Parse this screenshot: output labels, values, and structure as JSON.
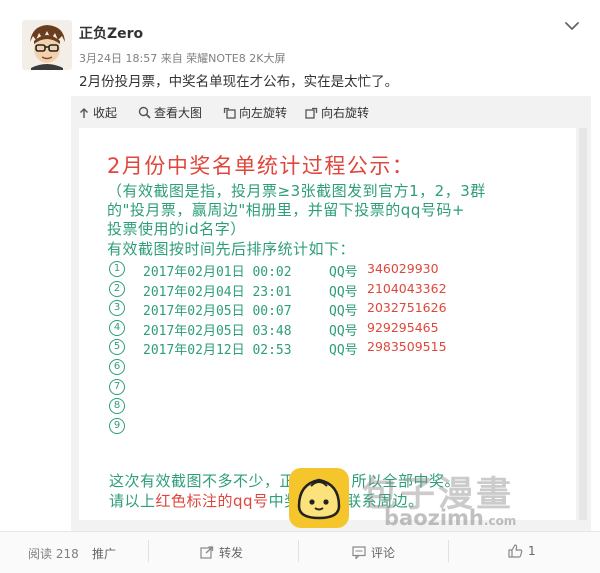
{
  "post": {
    "username": "正负Zero",
    "meta": "3月24日 18:57 来自 荣耀NOTE8 2K大屏",
    "text": "2月份投月票，中奖名单现在才公布，实在是太忙了。"
  },
  "toolbar": {
    "collapse_label": "收起",
    "view_large_label": "查看大图",
    "rotate_left_label": "向左旋转",
    "rotate_right_label": "向右旋转"
  },
  "image": {
    "title": "2月份中奖名单统计过程公示：",
    "note_lines": [
      "（有效截图是指，投月票≥3张截图发到官方1，2，3群",
      "的\"投月票，赢周边\"相册里，并留下投票的qq号码+",
      "投票使用的id名字）",
      "有效截图按时间先后排序统计如下："
    ],
    "entries": [
      {
        "num": "1",
        "date": "2017年02月01日 00:02",
        "qq_label": "QQ号",
        "qq": "346029930"
      },
      {
        "num": "2",
        "date": "2017年02月04日 23:01",
        "qq_label": "QQ号",
        "qq": "2104043362"
      },
      {
        "num": "3",
        "date": "2017年02月05日 00:07",
        "qq_label": "QQ号",
        "qq": "2032751626"
      },
      {
        "num": "4",
        "date": "2017年02月05日 03:48",
        "qq_label": "QQ号",
        "qq": "929295465"
      },
      {
        "num": "5",
        "date": "2017年02月12日 02:53",
        "qq_label": "QQ号",
        "qq": "2983509515"
      },
      {
        "num": "6",
        "date": "",
        "qq_label": "",
        "qq": ""
      },
      {
        "num": "7",
        "date": "",
        "qq_label": "",
        "qq": ""
      },
      {
        "num": "8",
        "date": "",
        "qq_label": "",
        "qq": ""
      },
      {
        "num": "9",
        "date": "",
        "qq_label": "",
        "qq": ""
      }
    ],
    "footer_line1": "这次有效截图不多不少，正好5个，所以全部中奖。",
    "footer_line2_pre": "请以上",
    "footer_line2_red": "红色标注的qq号",
    "footer_line2_post": "中奖者尽快联系周边。"
  },
  "watermark": {
    "brand": "包子漫畫",
    "url": "baozimh",
    "url_suffix": ".com"
  },
  "footer": {
    "read_label": "阅读 218",
    "promote_label": "推广",
    "share_label": "转发",
    "comment_label": "评论",
    "like_count": "1"
  },
  "colors": {
    "note_green": "#2d9e79",
    "highlight_red": "#e0463c",
    "watermark_yellow": "#f5c62c"
  }
}
